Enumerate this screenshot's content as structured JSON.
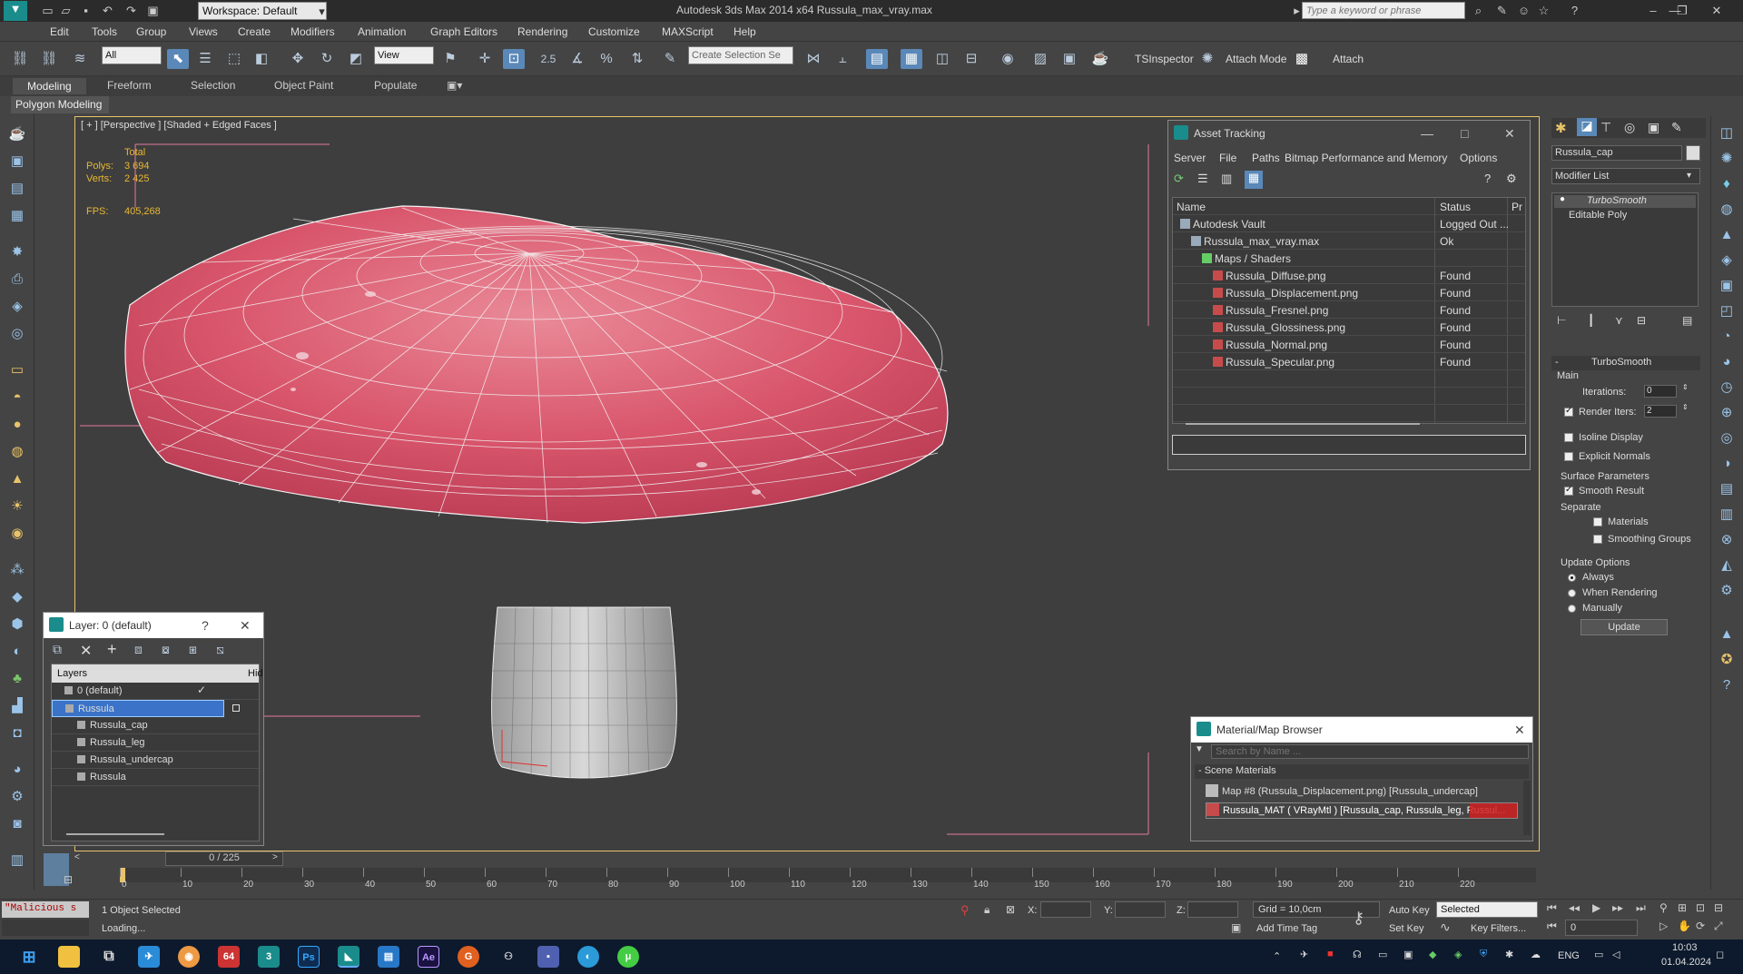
{
  "titlebar": {
    "workspace": "Workspace: Default",
    "app_title": "Autodesk 3ds Max  2014 x64     Russula_max_vray.max",
    "search_placeholder": "Type a keyword or phrase"
  },
  "menu": [
    "Edit",
    "Tools",
    "Group",
    "Views",
    "Create",
    "Modifiers",
    "Animation",
    "Graph Editors",
    "Rendering",
    "Customize",
    "MAXScript",
    "Help"
  ],
  "toolbar": {
    "selection_filter": "All",
    "reference_coord": "View",
    "create_selection_set": "Create Selection Se",
    "tsinspector_label": "TSInspector",
    "attach_mode_label": "Attach Mode",
    "attach_label": "Attach",
    "snap_value": "2.5"
  },
  "ribbon": {
    "tabs": [
      "Modeling",
      "Freeform",
      "Selection",
      "Object Paint",
      "Populate"
    ],
    "active_tab": "Modeling",
    "panel_label": "Polygon Modeling"
  },
  "viewport": {
    "label": "[ + ] [Perspective ] [Shaded + Edged Faces ]",
    "stats": {
      "total_label": "Total",
      "polys_label": "Polys:",
      "polys_value": "3 694",
      "verts_label": "Verts:",
      "verts_value": "2 425",
      "fps_label": "FPS:",
      "fps_value": "405,268"
    }
  },
  "asset_tracking": {
    "title": "Asset Tracking",
    "menu": [
      "Server",
      "File",
      "Paths",
      "Bitmap Performance and Memory",
      "Options"
    ],
    "columns": [
      "Name",
      "Status",
      "Pr"
    ],
    "rows": [
      {
        "name": "Autodesk Vault",
        "status": "Logged Out ...",
        "indent": 0
      },
      {
        "name": "Russula_max_vray.max",
        "status": "Ok",
        "indent": 1
      },
      {
        "name": "Maps / Shaders",
        "status": "",
        "indent": 2
      },
      {
        "name": "Russula_Diffuse.png",
        "status": "Found",
        "indent": 3
      },
      {
        "name": "Russula_Displacement.png",
        "status": "Found",
        "indent": 3
      },
      {
        "name": "Russula_Fresnel.png",
        "status": "Found",
        "indent": 3
      },
      {
        "name": "Russula_Glossiness.png",
        "status": "Found",
        "indent": 3
      },
      {
        "name": "Russula_Normal.png",
        "status": "Found",
        "indent": 3
      },
      {
        "name": "Russula_Specular.png",
        "status": "Found",
        "indent": 3
      }
    ]
  },
  "layers_panel": {
    "title": "Layer: 0 (default)",
    "help": "?",
    "columns": [
      "Layers",
      "Hid"
    ],
    "rows": [
      {
        "name": "0 (default)",
        "indent": 1,
        "selected": false
      },
      {
        "name": "Russula",
        "indent": 1,
        "selected": true
      },
      {
        "name": "Russula_cap",
        "indent": 2,
        "selected": false
      },
      {
        "name": "Russula_leg",
        "indent": 2,
        "selected": false
      },
      {
        "name": "Russula_undercap",
        "indent": 2,
        "selected": false
      },
      {
        "name": "Russula",
        "indent": 2,
        "selected": false
      }
    ]
  },
  "material_browser": {
    "title": "Material/Map Browser",
    "search_placeholder": "Search by Name ...",
    "section": "- Scene Materials",
    "items": [
      "Map #8 (Russula_Displacement.png) [Russula_undercap]",
      "Russula_MAT ( VRayMtl ) [Russula_cap, Russula_leg, Russul..."
    ]
  },
  "command_panel": {
    "object_name": "Russula_cap",
    "modifier_list": "Modifier List",
    "stack": [
      "TurboSmooth",
      "Editable Poly"
    ],
    "rollout_title": "TurboSmooth",
    "main_label": "Main",
    "iterations_label": "Iterations:",
    "iterations_value": "0",
    "render_iters_label": "Render Iters:",
    "render_iters_value": "2",
    "render_iters_checked": true,
    "isoline_label": "Isoline Display",
    "explicit_normals_label": "Explicit Normals",
    "surface_params_label": "Surface Parameters",
    "smooth_result_label": "Smooth Result",
    "smooth_result_checked": true,
    "separate_label": "Separate",
    "materials_label": "Materials",
    "smoothing_groups_label": "Smoothing Groups",
    "update_options_label": "Update Options",
    "always_label": "Always",
    "when_rendering_label": "When Rendering",
    "manually_label": "Manually",
    "update_button": "Update"
  },
  "timeline": {
    "frame_display": "0 / 225",
    "ticks": [
      "0",
      "10",
      "20",
      "30",
      "40",
      "50",
      "60",
      "70",
      "80",
      "90",
      "100",
      "110",
      "120",
      "130",
      "140",
      "150",
      "160",
      "170",
      "180",
      "190",
      "200",
      "210",
      "220"
    ]
  },
  "statusbar": {
    "maxscript_listener": "\"Malicious s",
    "selection_status": "1 Object Selected",
    "prompt": "Loading...",
    "x_label": "X:",
    "y_label": "Y:",
    "z_label": "Z:",
    "grid": "Grid = 10,0cm",
    "add_time_tag": "Add Time Tag",
    "auto_key": "Auto Key",
    "set_key": "Set Key",
    "selected_dropdown": "Selected",
    "key_filters": "Key Filters...",
    "frame_value": "0"
  },
  "taskbar": {
    "language": "ENG",
    "time": "10:03",
    "date": "01.04.2024"
  },
  "colors": {
    "cap": "#d9566c",
    "viewport_bg": "#3e3e3e",
    "selection_blue": "#3a73c7"
  }
}
